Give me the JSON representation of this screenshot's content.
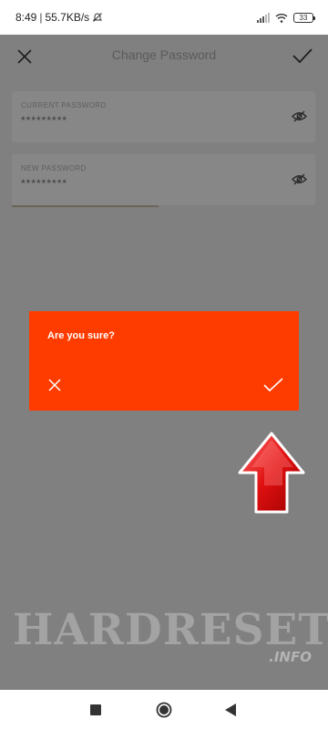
{
  "status_bar": {
    "time": "8:49",
    "separator": "|",
    "network_speed": "55.7KB/s",
    "alarm_icon": "alarm-off-icon",
    "signal_icon": "signal-bars-icon",
    "wifi_icon": "wifi-icon",
    "battery_level": "33"
  },
  "toolbar": {
    "title": "Change Password",
    "close_icon": "close-icon",
    "confirm_icon": "checkmark-icon"
  },
  "fields": {
    "current_password": {
      "label": "CURRENT PASSWORD",
      "value": "*********",
      "icon": "eye-hidden-icon"
    },
    "new_password": {
      "label": "NEW PASSWORD",
      "value": "*********",
      "icon": "eye-hidden-icon"
    }
  },
  "dialog": {
    "message": "Are you sure?",
    "cancel_icon": "close-icon",
    "confirm_icon": "checkmark-icon",
    "color": "#ff3c00"
  },
  "annotation": {
    "icon": "red-arrow-up-icon"
  },
  "watermark": {
    "main": "HARDRESET",
    "sub": ".INFO"
  },
  "nav_bar": {
    "recents_icon": "square-icon",
    "home_icon": "circle-icon",
    "back_icon": "triangle-back-icon"
  }
}
